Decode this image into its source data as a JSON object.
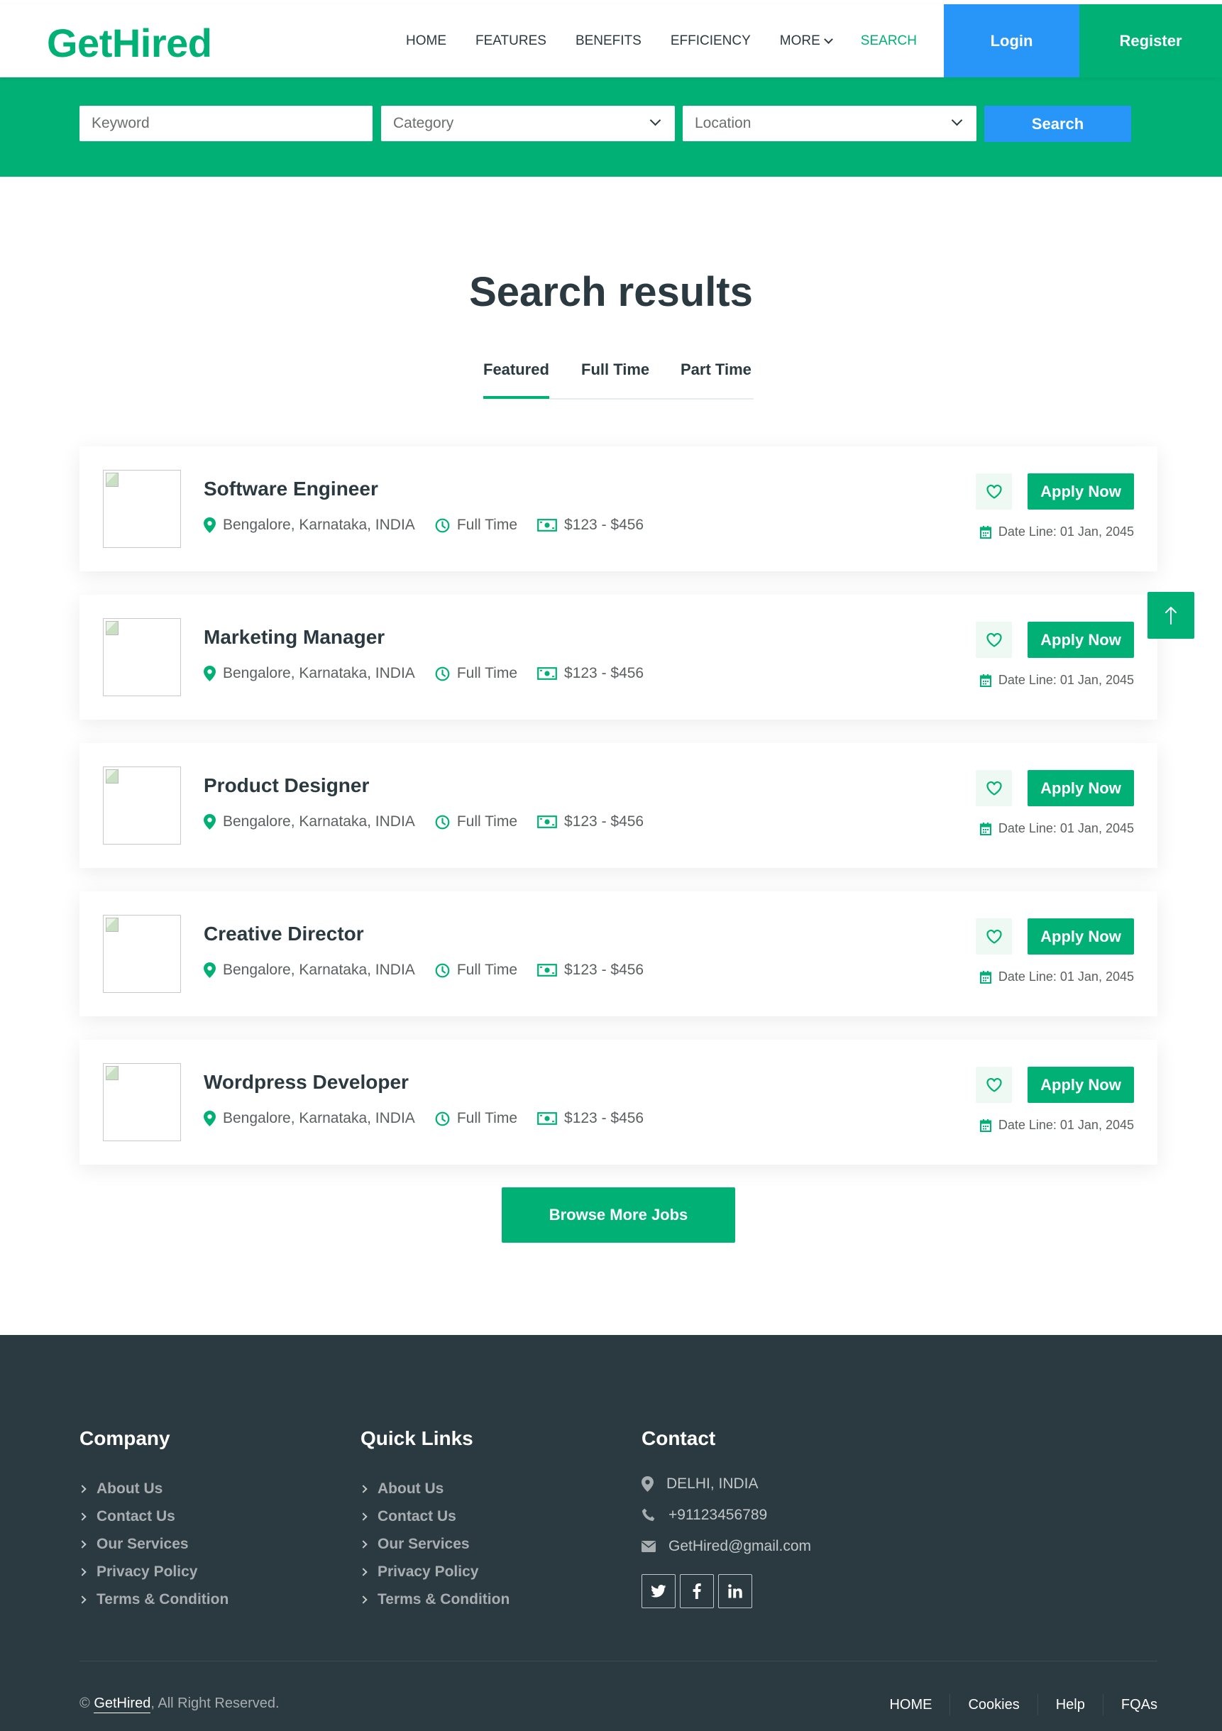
{
  "header": {
    "logo": "GetHired",
    "nav": [
      "HOME",
      "FEATURES",
      "BENEFITS",
      "EFFICIENCY",
      "MORE",
      "SEARCH"
    ],
    "login_label": "Login",
    "register_label": "Register"
  },
  "search": {
    "keyword_placeholder": "Keyword",
    "category_placeholder": "Category",
    "location_placeholder": "Location",
    "button_label": "Search"
  },
  "main": {
    "title": "Search results",
    "tabs": [
      "Featured",
      "Full Time",
      "Part Time"
    ],
    "apply_label": "Apply Now",
    "browse_label": "Browse More Jobs",
    "jobs": [
      {
        "title": "Software Engineer",
        "location": "Bengalore, Karnataka, INDIA",
        "type": "Full Time",
        "salary": "$123 - $456",
        "deadline": "Date Line: 01 Jan, 2045"
      },
      {
        "title": "Marketing Manager",
        "location": "Bengalore, Karnataka, INDIA",
        "type": "Full Time",
        "salary": "$123 - $456",
        "deadline": "Date Line: 01 Jan, 2045"
      },
      {
        "title": "Product Designer",
        "location": "Bengalore, Karnataka, INDIA",
        "type": "Full Time",
        "salary": "$123 - $456",
        "deadline": "Date Line: 01 Jan, 2045"
      },
      {
        "title": "Creative Director",
        "location": "Bengalore, Karnataka, INDIA",
        "type": "Full Time",
        "salary": "$123 - $456",
        "deadline": "Date Line: 01 Jan, 2045"
      },
      {
        "title": "Wordpress Developer",
        "location": "Bengalore, Karnataka, INDIA",
        "type": "Full Time",
        "salary": "$123 - $456",
        "deadline": "Date Line: 01 Jan, 2045"
      }
    ]
  },
  "footer": {
    "company_title": "Company",
    "company_links": [
      "About Us",
      "Contact Us",
      "Our Services",
      "Privacy Policy",
      "Terms & Condition"
    ],
    "quick_title": "Quick Links",
    "quick_links": [
      "About Us",
      "Contact Us",
      "Our Services",
      "Privacy Policy",
      "Terms & Condition"
    ],
    "contact_title": "Contact",
    "address": "DELHI, INDIA",
    "phone": "+91123456789",
    "email": "GetHired@gmail.com",
    "socials": [
      "twitter-icon",
      "facebook-icon",
      "linkedin-icon"
    ],
    "copyright_prefix": "©",
    "copyright_brand": "GetHired",
    "copyright_suffix": ", All Right Reserved.",
    "bottom_links": [
      "HOME",
      "Cookies",
      "Help",
      "FQAs"
    ]
  },
  "colors": {
    "brand_green": "#00b074",
    "accent_blue": "#2896f9",
    "dark": "#2b3940"
  }
}
